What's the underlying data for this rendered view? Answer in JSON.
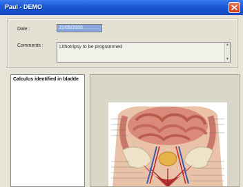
{
  "window": {
    "title": "Paul - DEMO"
  },
  "form": {
    "date_label": "Date :",
    "date_value": "21/05/2005",
    "comments_label": "Comments :",
    "comments_value": "Lithotripsy to be programmed"
  },
  "list": {
    "items": [
      "Calculus identified in bladde"
    ]
  },
  "image": {
    "icon": "anatomy-illustration"
  },
  "colors": {
    "titlebar": "#1c5ad6",
    "window_bg": "#e6e4d6",
    "date_field_bg": "#8aa8dc",
    "close_button": "#c83a1c"
  }
}
